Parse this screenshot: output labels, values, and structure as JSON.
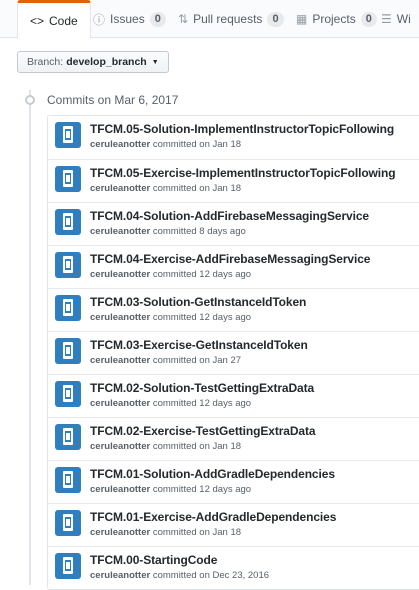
{
  "tabs": [
    {
      "label": "Code",
      "icon": "code-icon",
      "selected": true
    },
    {
      "label": "Issues",
      "icon": "issue-icon",
      "count": "0"
    },
    {
      "label": "Pull requests",
      "icon": "pull-request-icon",
      "count": "0"
    },
    {
      "label": "Projects",
      "icon": "project-icon",
      "count": "0"
    },
    {
      "label": "Wi",
      "icon": "book-icon"
    }
  ],
  "branch": {
    "prefix": "Branch:",
    "name": "develop_branch"
  },
  "group": {
    "title": "Commits on Mar 6, 2017"
  },
  "colors": {
    "accent_tab": "#e36209",
    "avatar": "#2f7ec0"
  },
  "commits": [
    {
      "message": "TFCM.05-Solution-ImplementInstructorTopicFollowing",
      "author": "ceruleanotter",
      "verb": "committed on",
      "date": "Jan 18"
    },
    {
      "message": "TFCM.05-Exercise-ImplementInstructorTopicFollowing",
      "author": "ceruleanotter",
      "verb": "committed on",
      "date": "Jan 18"
    },
    {
      "message": "TFCM.04-Solution-AddFirebaseMessagingService",
      "author": "ceruleanotter",
      "verb": "committed",
      "date": "8 days ago"
    },
    {
      "message": "TFCM.04-Exercise-AddFirebaseMessagingService",
      "author": "ceruleanotter",
      "verb": "committed",
      "date": "12 days ago"
    },
    {
      "message": "TFCM.03-Solution-GetInstanceIdToken",
      "author": "ceruleanotter",
      "verb": "committed",
      "date": "12 days ago"
    },
    {
      "message": "TFCM.03-Exercise-GetInstanceIdToken",
      "author": "ceruleanotter",
      "verb": "committed on",
      "date": "Jan 27"
    },
    {
      "message": "TFCM.02-Solution-TestGettingExtraData",
      "author": "ceruleanotter",
      "verb": "committed",
      "date": "12 days ago"
    },
    {
      "message": "TFCM.02-Exercise-TestGettingExtraData",
      "author": "ceruleanotter",
      "verb": "committed on",
      "date": "Jan 18"
    },
    {
      "message": "TFCM.01-Solution-AddGradleDependencies",
      "author": "ceruleanotter",
      "verb": "committed",
      "date": "12 days ago"
    },
    {
      "message": "TFCM.01-Exercise-AddGradleDependencies",
      "author": "ceruleanotter",
      "verb": "committed on",
      "date": "Jan 18"
    },
    {
      "message": "TFCM.00-StartingCode",
      "author": "ceruleanotter",
      "verb": "committed on",
      "date": "Dec 23, 2016"
    }
  ]
}
